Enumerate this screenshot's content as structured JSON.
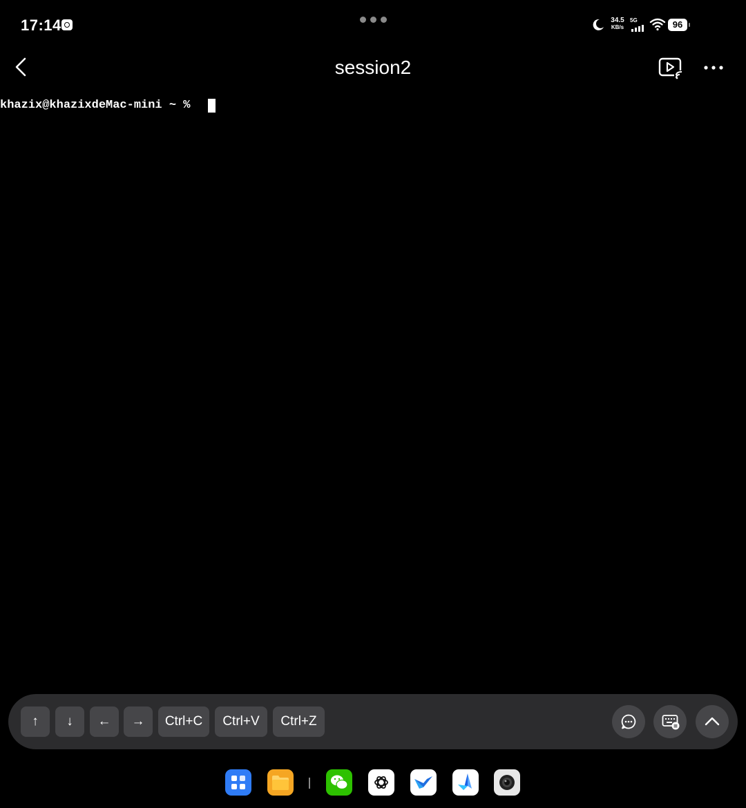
{
  "status_bar": {
    "time": "17:14",
    "net_speed_value": "34.5",
    "net_speed_unit": "KB/s",
    "network_type": "5G",
    "battery": "96",
    "icons": [
      "notification-icon",
      "moon-icon",
      "signal-icon",
      "wifi-icon",
      "battery-icon"
    ]
  },
  "header": {
    "title": "session2",
    "icons": [
      "back-arrow-icon",
      "cast-icon",
      "more-icon"
    ]
  },
  "terminal": {
    "prompt": "khazix@khazixdeMac-mini ~ % "
  },
  "toolbar": {
    "keys": [
      {
        "label": "↑",
        "name": "arrow-up"
      },
      {
        "label": "↓",
        "name": "arrow-down"
      },
      {
        "label": "←",
        "name": "arrow-left"
      },
      {
        "label": "→",
        "name": "arrow-right"
      },
      {
        "label": "Ctrl+C",
        "name": "ctrl-c"
      },
      {
        "label": "Ctrl+V",
        "name": "ctrl-v"
      },
      {
        "label": "Ctrl+Z",
        "name": "ctrl-z"
      }
    ],
    "round_buttons": [
      "chat-icon",
      "keyboard-icon",
      "chevron-up-icon"
    ]
  },
  "dock": {
    "apps": [
      "app-grid-icon",
      "files-icon",
      "wechat-icon",
      "chatgpt-icon",
      "bird-app-icon",
      "arrow-app-icon",
      "camera-icon"
    ]
  },
  "colors": {
    "background": "#000000",
    "toolbar": "#2c2c2e",
    "key": "#464649",
    "text": "#ffffff"
  }
}
